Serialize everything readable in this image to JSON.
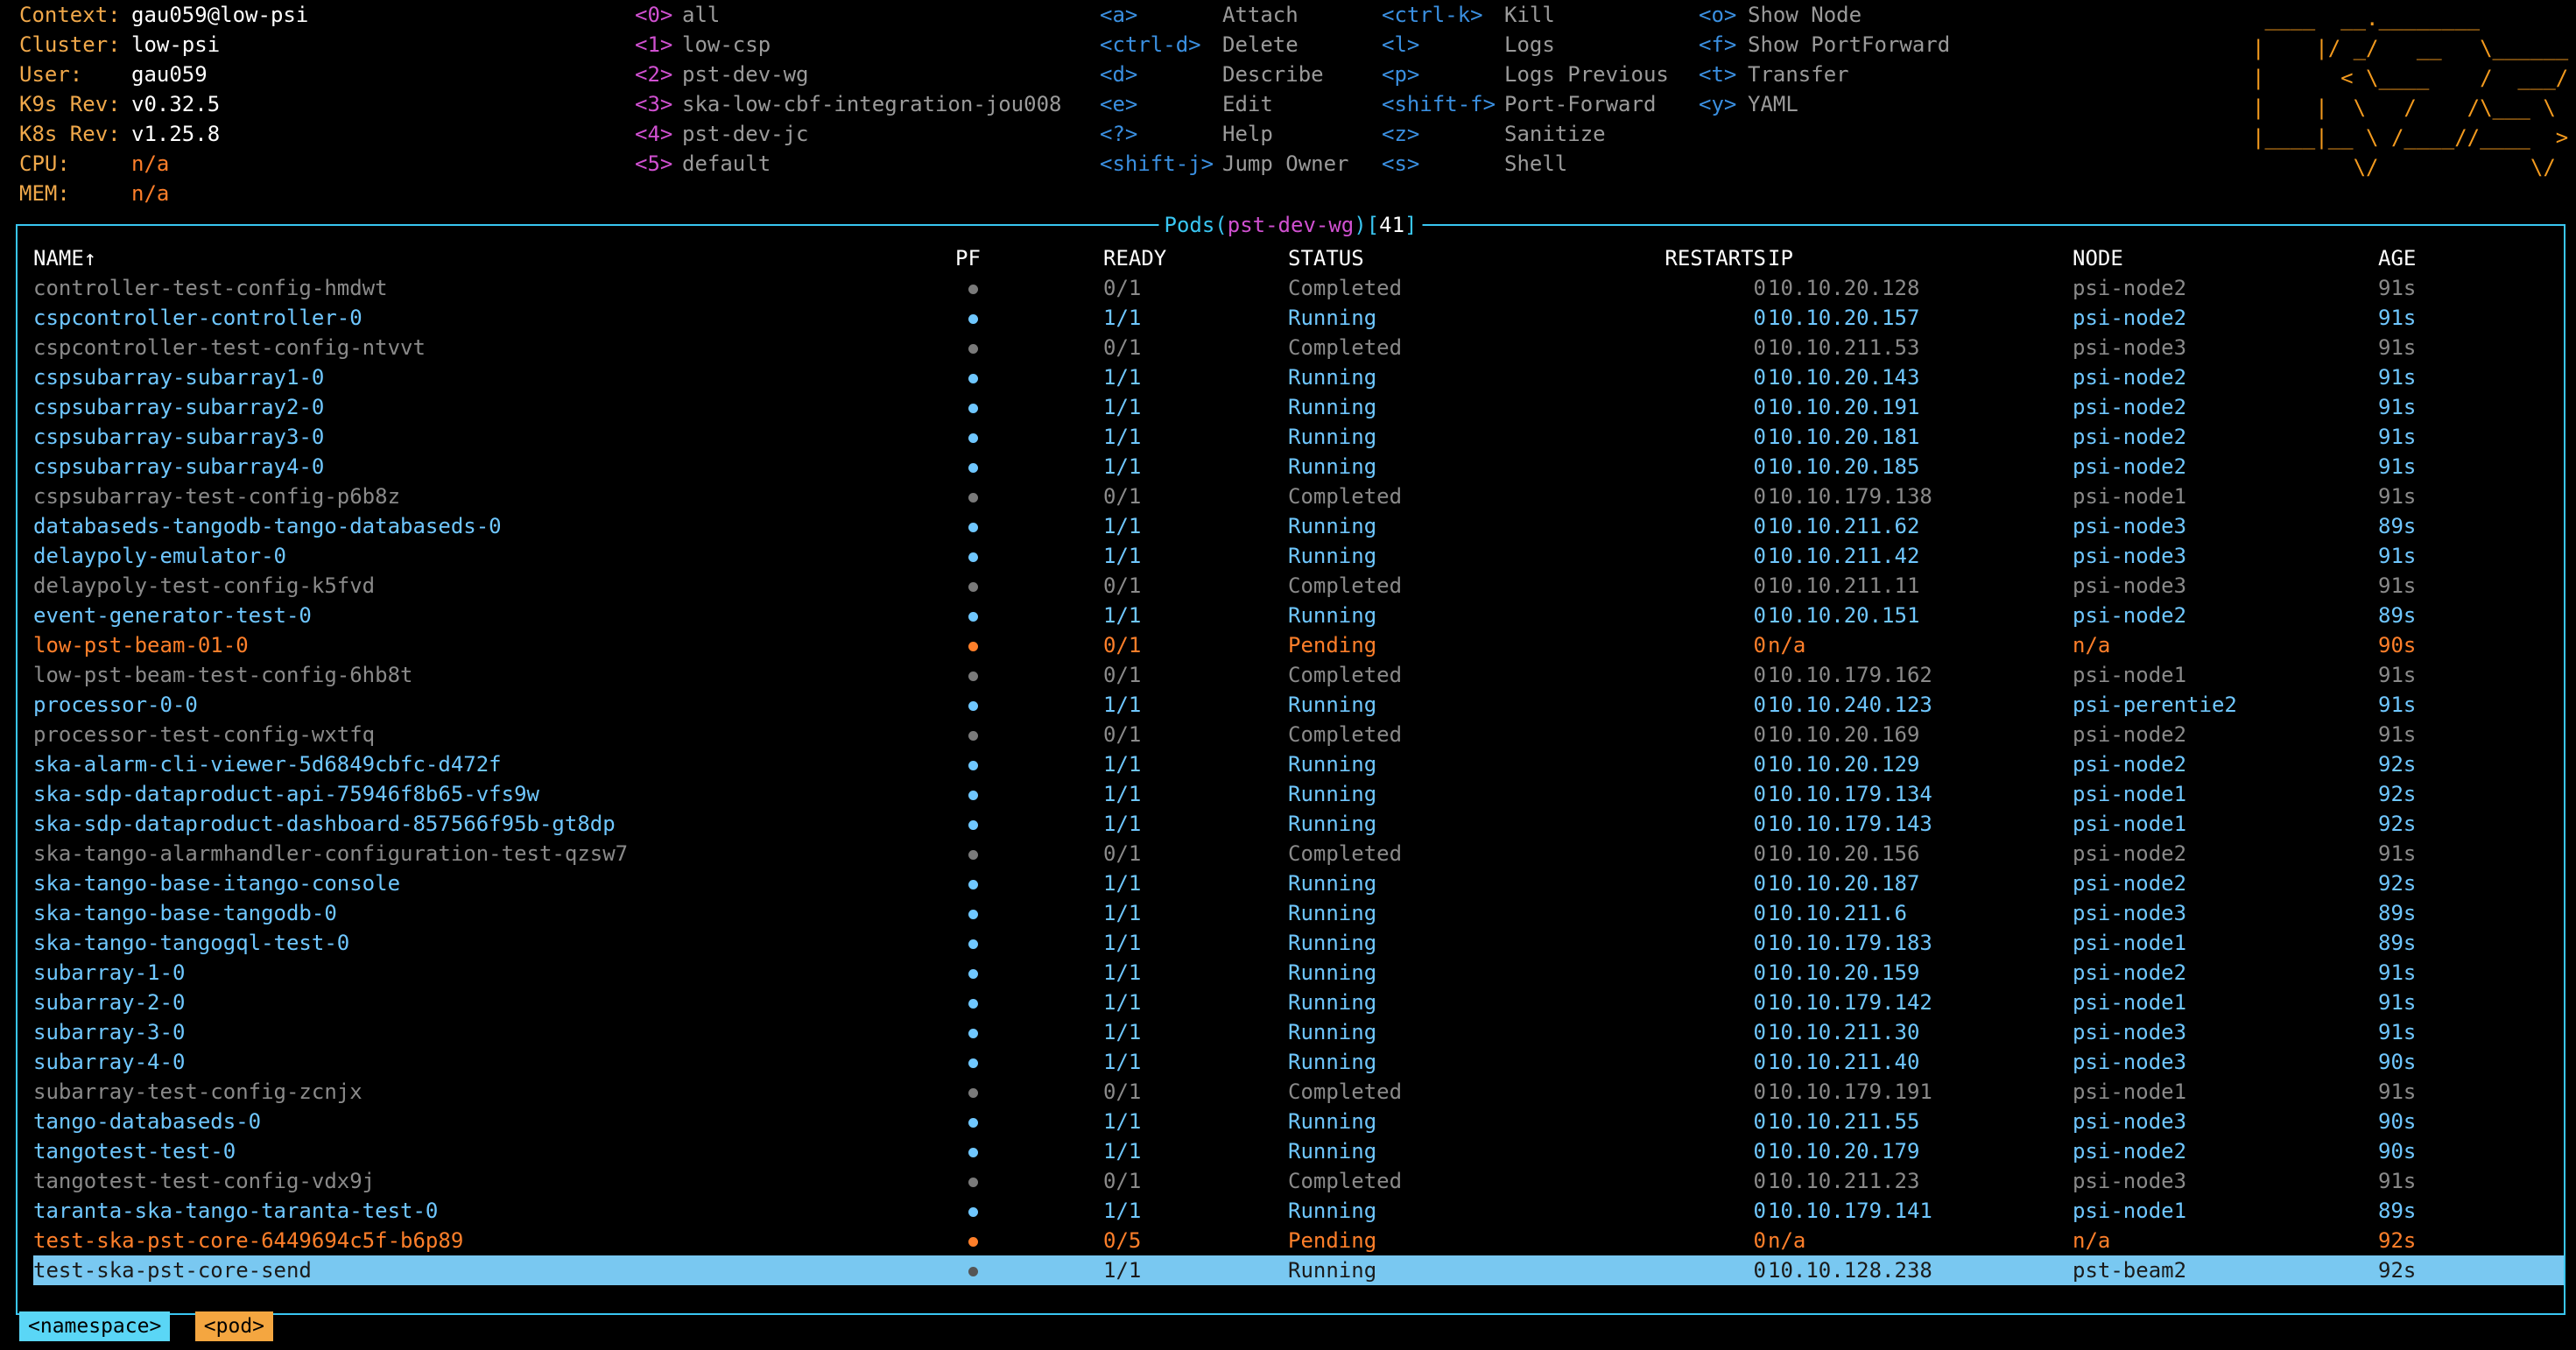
{
  "info": [
    {
      "key": "Context:",
      "value": "gau059@low-psi",
      "tone": "white"
    },
    {
      "key": "Cluster:",
      "value": "low-psi",
      "tone": "white"
    },
    {
      "key": "User:",
      "value": "gau059",
      "tone": "white"
    },
    {
      "key": "K9s Rev:",
      "value": "v0.32.5",
      "tone": "white"
    },
    {
      "key": "K8s Rev:",
      "value": "v1.25.8",
      "tone": "white"
    },
    {
      "key": "CPU:",
      "value": "n/a",
      "tone": "red"
    },
    {
      "key": "MEM:",
      "value": "n/a",
      "tone": "red"
    }
  ],
  "namespaces": [
    {
      "key": "<0>",
      "label": "all"
    },
    {
      "key": "<1>",
      "label": "low-csp"
    },
    {
      "key": "<2>",
      "label": "pst-dev-wg"
    },
    {
      "key": "<3>",
      "label": "ska-low-cbf-integration-jou008"
    },
    {
      "key": "<4>",
      "label": "pst-dev-jc"
    },
    {
      "key": "<5>",
      "label": "default"
    }
  ],
  "shortcuts_a": [
    {
      "key": "<a>",
      "label": "Attach"
    },
    {
      "key": "<ctrl-d>",
      "label": "Delete"
    },
    {
      "key": "<d>",
      "label": "Describe"
    },
    {
      "key": "<e>",
      "label": "Edit"
    },
    {
      "key": "<?>",
      "label": "Help"
    },
    {
      "key": "<shift-j>",
      "label": "Jump Owner"
    }
  ],
  "shortcuts_b": [
    {
      "key": "<ctrl-k>",
      "label": "Kill"
    },
    {
      "key": "<l>",
      "label": "Logs"
    },
    {
      "key": "<p>",
      "label": "Logs Previous"
    },
    {
      "key": "<shift-f>",
      "label": "Port-Forward"
    },
    {
      "key": "<z>",
      "label": "Sanitize"
    },
    {
      "key": "<s>",
      "label": "Shell"
    }
  ],
  "shortcuts_c": [
    {
      "key": "<o>",
      "label": "Show Node"
    },
    {
      "key": "<f>",
      "label": "Show PortForward"
    },
    {
      "key": "<t>",
      "label": "Transfer"
    },
    {
      "key": "<y>",
      "label": "YAML"
    }
  ],
  "logo_lines": [
    " ____  __.________       ",
    "|    |/ _/   __   \\______",
    "|      < \\____    /  ___/",
    "|    |  \\   /    /\\___ \\ ",
    "|____|__ \\ /____//____  >",
    "        \\/            \\/ "
  ],
  "frame": {
    "title_prefix": "Pods(",
    "namespace": "pst-dev-wg",
    "title_suffix": ")",
    "count_open": "[",
    "count": "41",
    "count_close": "]"
  },
  "columns": {
    "name": "NAME↑",
    "pf": "PF",
    "ready": "READY",
    "status": "STATUS",
    "restarts": "RESTARTS",
    "ip": "IP",
    "node": "NODE",
    "age": "AGE"
  },
  "pods": [
    {
      "name": "controller-test-config-hmdwt",
      "ready": "0/1",
      "status": "Completed",
      "restarts": "0",
      "ip": "10.10.20.128",
      "node": "psi-node2",
      "age": "91s",
      "state": "completed"
    },
    {
      "name": "cspcontroller-controller-0",
      "ready": "1/1",
      "status": "Running",
      "restarts": "0",
      "ip": "10.10.20.157",
      "node": "psi-node2",
      "age": "91s",
      "state": "running"
    },
    {
      "name": "cspcontroller-test-config-ntvvt",
      "ready": "0/1",
      "status": "Completed",
      "restarts": "0",
      "ip": "10.10.211.53",
      "node": "psi-node3",
      "age": "91s",
      "state": "completed"
    },
    {
      "name": "cspsubarray-subarray1-0",
      "ready": "1/1",
      "status": "Running",
      "restarts": "0",
      "ip": "10.10.20.143",
      "node": "psi-node2",
      "age": "91s",
      "state": "running"
    },
    {
      "name": "cspsubarray-subarray2-0",
      "ready": "1/1",
      "status": "Running",
      "restarts": "0",
      "ip": "10.10.20.191",
      "node": "psi-node2",
      "age": "91s",
      "state": "running"
    },
    {
      "name": "cspsubarray-subarray3-0",
      "ready": "1/1",
      "status": "Running",
      "restarts": "0",
      "ip": "10.10.20.181",
      "node": "psi-node2",
      "age": "91s",
      "state": "running"
    },
    {
      "name": "cspsubarray-subarray4-0",
      "ready": "1/1",
      "status": "Running",
      "restarts": "0",
      "ip": "10.10.20.185",
      "node": "psi-node2",
      "age": "91s",
      "state": "running"
    },
    {
      "name": "cspsubarray-test-config-p6b8z",
      "ready": "0/1",
      "status": "Completed",
      "restarts": "0",
      "ip": "10.10.179.138",
      "node": "psi-node1",
      "age": "91s",
      "state": "completed"
    },
    {
      "name": "databaseds-tangodb-tango-databaseds-0",
      "ready": "1/1",
      "status": "Running",
      "restarts": "0",
      "ip": "10.10.211.62",
      "node": "psi-node3",
      "age": "89s",
      "state": "running"
    },
    {
      "name": "delaypoly-emulator-0",
      "ready": "1/1",
      "status": "Running",
      "restarts": "0",
      "ip": "10.10.211.42",
      "node": "psi-node3",
      "age": "91s",
      "state": "running"
    },
    {
      "name": "delaypoly-test-config-k5fvd",
      "ready": "0/1",
      "status": "Completed",
      "restarts": "0",
      "ip": "10.10.211.11",
      "node": "psi-node3",
      "age": "91s",
      "state": "completed"
    },
    {
      "name": "event-generator-test-0",
      "ready": "1/1",
      "status": "Running",
      "restarts": "0",
      "ip": "10.10.20.151",
      "node": "psi-node2",
      "age": "89s",
      "state": "running"
    },
    {
      "name": "low-pst-beam-01-0",
      "ready": "0/1",
      "status": "Pending",
      "restarts": "0",
      "ip": "n/a",
      "node": "n/a",
      "age": "90s",
      "state": "pending"
    },
    {
      "name": "low-pst-beam-test-config-6hb8t",
      "ready": "0/1",
      "status": "Completed",
      "restarts": "0",
      "ip": "10.10.179.162",
      "node": "psi-node1",
      "age": "91s",
      "state": "completed"
    },
    {
      "name": "processor-0-0",
      "ready": "1/1",
      "status": "Running",
      "restarts": "0",
      "ip": "10.10.240.123",
      "node": "psi-perentie2",
      "age": "91s",
      "state": "running"
    },
    {
      "name": "processor-test-config-wxtfq",
      "ready": "0/1",
      "status": "Completed",
      "restarts": "0",
      "ip": "10.10.20.169",
      "node": "psi-node2",
      "age": "91s",
      "state": "completed"
    },
    {
      "name": "ska-alarm-cli-viewer-5d6849cbfc-d472f",
      "ready": "1/1",
      "status": "Running",
      "restarts": "0",
      "ip": "10.10.20.129",
      "node": "psi-node2",
      "age": "92s",
      "state": "running"
    },
    {
      "name": "ska-sdp-dataproduct-api-75946f8b65-vfs9w",
      "ready": "1/1",
      "status": "Running",
      "restarts": "0",
      "ip": "10.10.179.134",
      "node": "psi-node1",
      "age": "92s",
      "state": "running"
    },
    {
      "name": "ska-sdp-dataproduct-dashboard-857566f95b-gt8dp",
      "ready": "1/1",
      "status": "Running",
      "restarts": "0",
      "ip": "10.10.179.143",
      "node": "psi-node1",
      "age": "92s",
      "state": "running"
    },
    {
      "name": "ska-tango-alarmhandler-configuration-test-qzsw7",
      "ready": "0/1",
      "status": "Completed",
      "restarts": "0",
      "ip": "10.10.20.156",
      "node": "psi-node2",
      "age": "91s",
      "state": "completed"
    },
    {
      "name": "ska-tango-base-itango-console",
      "ready": "1/1",
      "status": "Running",
      "restarts": "0",
      "ip": "10.10.20.187",
      "node": "psi-node2",
      "age": "92s",
      "state": "running"
    },
    {
      "name": "ska-tango-base-tangodb-0",
      "ready": "1/1",
      "status": "Running",
      "restarts": "0",
      "ip": "10.10.211.6",
      "node": "psi-node3",
      "age": "89s",
      "state": "running"
    },
    {
      "name": "ska-tango-tangogql-test-0",
      "ready": "1/1",
      "status": "Running",
      "restarts": "0",
      "ip": "10.10.179.183",
      "node": "psi-node1",
      "age": "89s",
      "state": "running"
    },
    {
      "name": "subarray-1-0",
      "ready": "1/1",
      "status": "Running",
      "restarts": "0",
      "ip": "10.10.20.159",
      "node": "psi-node2",
      "age": "91s",
      "state": "running"
    },
    {
      "name": "subarray-2-0",
      "ready": "1/1",
      "status": "Running",
      "restarts": "0",
      "ip": "10.10.179.142",
      "node": "psi-node1",
      "age": "91s",
      "state": "running"
    },
    {
      "name": "subarray-3-0",
      "ready": "1/1",
      "status": "Running",
      "restarts": "0",
      "ip": "10.10.211.30",
      "node": "psi-node3",
      "age": "91s",
      "state": "running"
    },
    {
      "name": "subarray-4-0",
      "ready": "1/1",
      "status": "Running",
      "restarts": "0",
      "ip": "10.10.211.40",
      "node": "psi-node3",
      "age": "90s",
      "state": "running"
    },
    {
      "name": "subarray-test-config-zcnjx",
      "ready": "0/1",
      "status": "Completed",
      "restarts": "0",
      "ip": "10.10.179.191",
      "node": "psi-node1",
      "age": "91s",
      "state": "completed"
    },
    {
      "name": "tango-databaseds-0",
      "ready": "1/1",
      "status": "Running",
      "restarts": "0",
      "ip": "10.10.211.55",
      "node": "psi-node3",
      "age": "90s",
      "state": "running"
    },
    {
      "name": "tangotest-test-0",
      "ready": "1/1",
      "status": "Running",
      "restarts": "0",
      "ip": "10.10.20.179",
      "node": "psi-node2",
      "age": "90s",
      "state": "running"
    },
    {
      "name": "tangotest-test-config-vdx9j",
      "ready": "0/1",
      "status": "Completed",
      "restarts": "0",
      "ip": "10.10.211.23",
      "node": "psi-node3",
      "age": "91s",
      "state": "completed"
    },
    {
      "name": "taranta-ska-tango-taranta-test-0",
      "ready": "1/1",
      "status": "Running",
      "restarts": "0",
      "ip": "10.10.179.141",
      "node": "psi-node1",
      "age": "89s",
      "state": "running"
    },
    {
      "name": "test-ska-pst-core-6449694c5f-b6p89",
      "ready": "0/5",
      "status": "Pending",
      "restarts": "0",
      "ip": "n/a",
      "node": "n/a",
      "age": "92s",
      "state": "pending"
    },
    {
      "name": "test-ska-pst-core-send",
      "ready": "1/1",
      "status": "Running",
      "restarts": "0",
      "ip": "10.10.128.238",
      "node": "pst-beam2",
      "age": "92s",
      "state": "selected"
    }
  ],
  "crumbs": [
    "<namespace>",
    "<pod>"
  ],
  "colors": {
    "accent": "#39c6f2",
    "running": "#6fc7ff",
    "pending": "#ff7f2a",
    "completed": "#8a8a8a",
    "selected_bg": "#79c8f1",
    "logo": "#f39a1e"
  }
}
